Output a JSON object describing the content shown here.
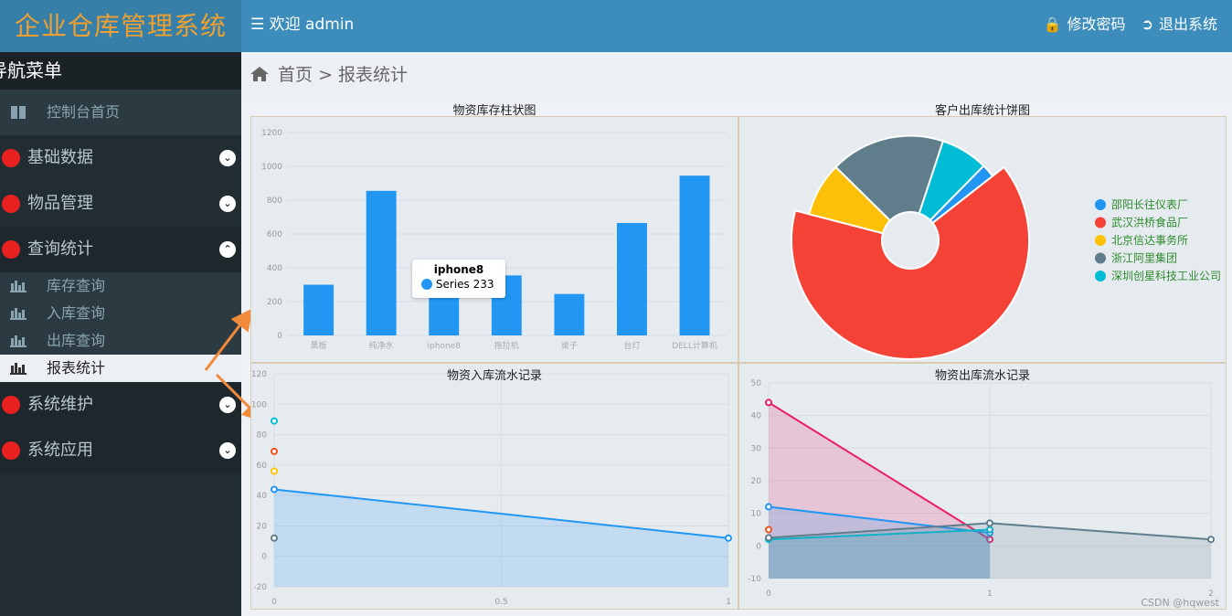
{
  "app": {
    "title": "企业仓库管理系统",
    "welcome": "欢迎 admin",
    "change_password": "修改密码",
    "logout": "退出系统"
  },
  "sidebar": {
    "header": "导航菜单",
    "home": "控制台首页",
    "groups": [
      {
        "label": "基础数据"
      },
      {
        "label": "物品管理"
      },
      {
        "label": "查询统计"
      }
    ],
    "subitems": [
      {
        "label": "库存查询"
      },
      {
        "label": "入库查询"
      },
      {
        "label": "出库查询"
      },
      {
        "label": "报表统计"
      }
    ],
    "more": [
      {
        "label": "系统维护"
      },
      {
        "label": "系统应用"
      }
    ]
  },
  "breadcrumb": {
    "home": "首页",
    "sep": ">",
    "current": "报表统计"
  },
  "charts": [
    {
      "title": "物资库存柱状图"
    },
    {
      "title": "客户出库统计饼图"
    },
    {
      "title": "物资入库流水记录"
    },
    {
      "title": "物资出库流水记录"
    }
  ],
  "tooltip": {
    "title": "iphone8",
    "series": "Series",
    "value": "233"
  },
  "watermark": "CSDN @hqwest",
  "chart_data": [
    {
      "type": "bar",
      "categories": [
        "黑板",
        "纯净水",
        "iphone8",
        "拖拉机",
        "桌子",
        "台灯",
        "DELL计算机"
      ],
      "values": [
        300,
        855,
        233,
        355,
        245,
        665,
        945
      ],
      "ylim": [
        0,
        1200
      ],
      "yticks": [
        0,
        200,
        400,
        600,
        800,
        1000,
        1200
      ],
      "color": "#2196f3"
    },
    {
      "type": "pie",
      "legend": [
        "邵阳长往仪表厂",
        "武汉洪桥食品厂",
        "北京信达事务所",
        "浙江阿里集团",
        "深圳创星科技工业公司"
      ],
      "values": [
        2,
        62,
        8,
        17,
        7
      ],
      "colors": [
        "#2196f3",
        "#f44336",
        "#ffc107",
        "#607d8b",
        "#00bcd4"
      ],
      "legend_position": "right"
    },
    {
      "type": "line",
      "x": [
        0,
        0.5,
        1
      ],
      "series": [
        {
          "values": [
            [
              0,
              44
            ],
            [
              1,
              12
            ]
          ],
          "color": "#2196f3"
        },
        {
          "values": [
            [
              0,
              89
            ]
          ],
          "color": "#00bcd4"
        },
        {
          "values": [
            [
              0,
              69
            ]
          ],
          "color": "#f4511e"
        },
        {
          "values": [
            [
              0,
              56
            ]
          ],
          "color": "#ffc107"
        },
        {
          "values": [
            [
              0,
              12
            ]
          ],
          "color": "#607d8b"
        }
      ],
      "ylim": [
        -20,
        120
      ],
      "yticks": [
        -20,
        0,
        20,
        40,
        60,
        80,
        100,
        120
      ],
      "xticks": [
        "0",
        "0.5",
        "1"
      ]
    },
    {
      "type": "line",
      "series": [
        {
          "values": [
            [
              0,
              44
            ],
            [
              1,
              2
            ]
          ],
          "color": "#e91e63"
        },
        {
          "values": [
            [
              0,
              12
            ],
            [
              1,
              4
            ]
          ],
          "color": "#2196f3"
        },
        {
          "values": [
            [
              0,
              2
            ],
            [
              1,
              5
            ]
          ],
          "color": "#00bcd4"
        },
        {
          "values": [
            [
              0,
              2.5
            ],
            [
              1,
              7
            ],
            [
              2,
              2
            ]
          ],
          "color": "#607d8b"
        },
        {
          "values": [
            [
              0,
              5
            ]
          ],
          "color": "#f4511e"
        }
      ],
      "ylim": [
        -10,
        50
      ],
      "yticks": [
        -10,
        0,
        10,
        20,
        30,
        40,
        50
      ],
      "xticks": [
        "0",
        "1",
        "2"
      ]
    }
  ]
}
